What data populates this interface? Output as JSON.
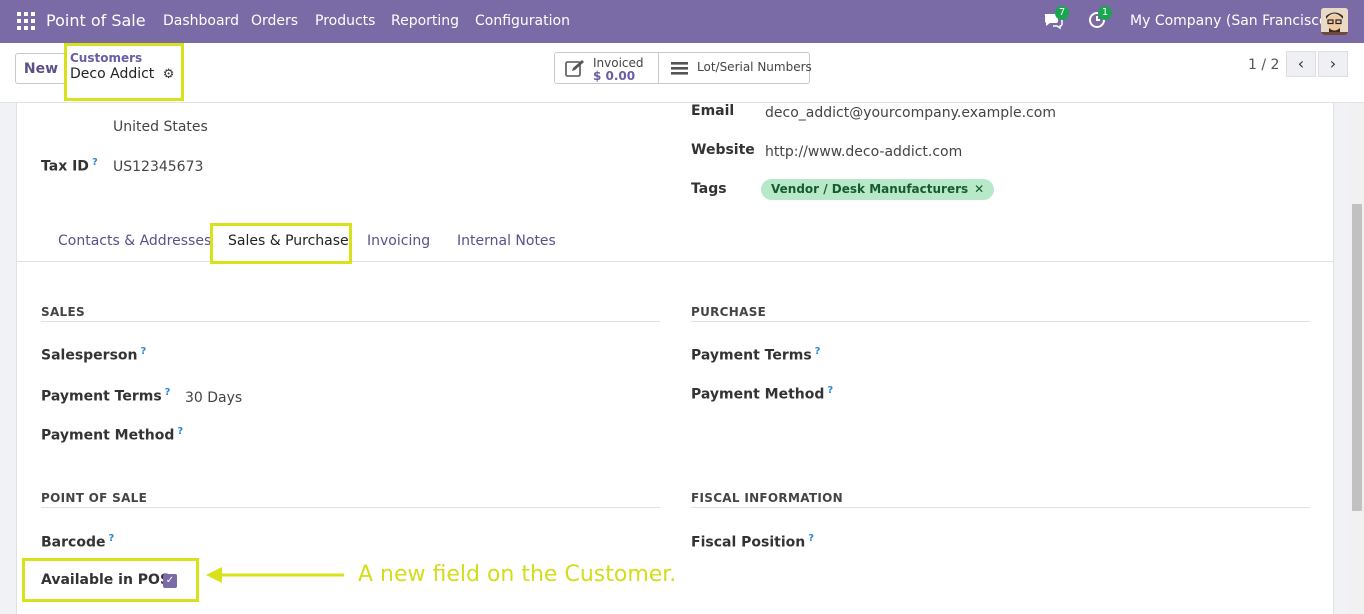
{
  "navbar": {
    "app_name": "Point of Sale",
    "menu": [
      "Dashboard",
      "Orders",
      "Products",
      "Reporting",
      "Configuration"
    ],
    "messages_count": "7",
    "activities_count": "1",
    "company": "My Company (San Francisco)",
    "accent": "#7a6aa6"
  },
  "control": {
    "new_label": "New",
    "breadcrumb_parent": "Customers",
    "breadcrumb_current": "Deco Addict",
    "invoiced_label": "Invoiced",
    "invoiced_value": "$ 0.00",
    "lot_label": "Lot/Serial Numbers",
    "pager": "1 / 2"
  },
  "form": {
    "address_country": "United States",
    "tax_id_label": "Tax ID",
    "tax_id_value": "US12345673",
    "email_label": "Email",
    "email_value": "deco_addict@yourcompany.example.com",
    "website_label": "Website",
    "website_value": "http://www.deco-addict.com",
    "tags_label": "Tags",
    "tag_value": "Vendor / Desk Manufacturers"
  },
  "tabs": [
    "Contacts & Addresses",
    "Sales & Purchase",
    "Invoicing",
    "Internal Notes"
  ],
  "sales": {
    "title": "SALES",
    "salesperson_label": "Salesperson",
    "payment_terms_label": "Payment Terms",
    "payment_terms_value": "30 Days",
    "payment_method_label": "Payment Method"
  },
  "purchase": {
    "title": "PURCHASE",
    "payment_terms_label": "Payment Terms",
    "payment_method_label": "Payment Method"
  },
  "pos": {
    "title": "POINT OF SALE",
    "barcode_label": "Barcode",
    "available_label": "Available in POS",
    "available_checked": true
  },
  "fiscal": {
    "title": "FISCAL INFORMATION",
    "fiscal_position_label": "Fiscal Position"
  },
  "annotation": {
    "text": "A new field on the Customer.",
    "highlight_color": "#d8e21b"
  }
}
